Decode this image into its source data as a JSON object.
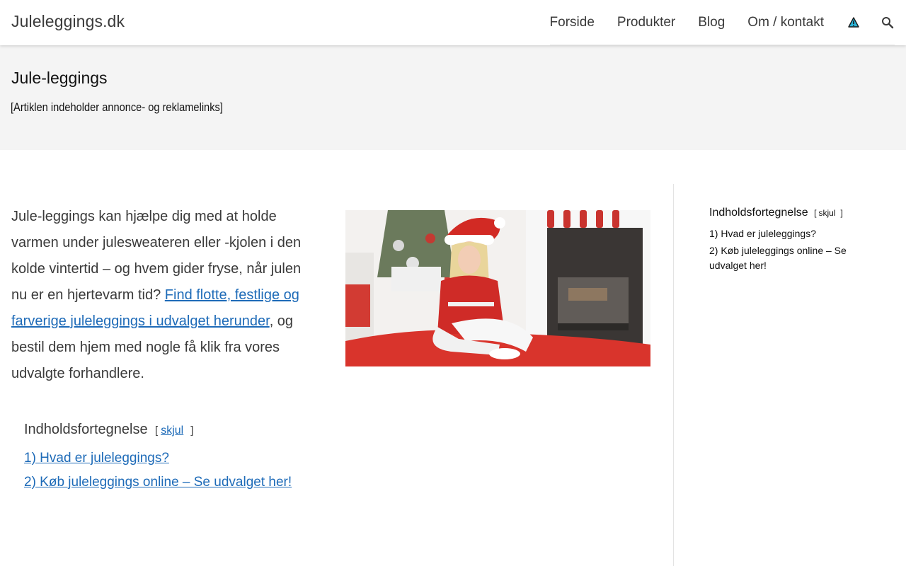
{
  "header": {
    "site_title": "Juleleggings.dk",
    "nav": [
      "Forside",
      "Produkter",
      "Blog",
      "Om / kontakt"
    ]
  },
  "page": {
    "title": "Jule-leggings",
    "ad_note": "[Artiklen indeholder annonce- og reklamelinks]"
  },
  "intro": {
    "text_before": "Jule-leggings kan hjælpe dig med at holde varmen under julesweateren eller -kjolen i den kolde vintertid – og hvem gider fryse, når julen nu er en hjertevarm tid? ",
    "link_text": "Find flotte, festlige og farverige juleleggings i udvalget herunder",
    "text_after": ", og bestil dem hjem med nogle få klik fra vores udvalgte forhandlere."
  },
  "toc": {
    "title": "Indholdsfortegnelse",
    "toggle": "skjul",
    "bracket_open": "[",
    "bracket_close": "]",
    "items": [
      "1) Hvad er juleleggings?",
      "2) Køb juleleggings online – Se udvalget her!"
    ]
  },
  "colors": {
    "link": "#1e6bb8",
    "band": "#f4f4f4",
    "text": "#3a3a3a"
  },
  "icons": {
    "warning": "warning-triangle-icon",
    "search": "search-icon"
  }
}
